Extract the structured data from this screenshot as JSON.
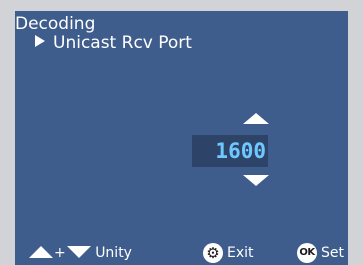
{
  "menu": {
    "title": "Decoding",
    "submenu": "Unicast Rcv Port"
  },
  "editor": {
    "value": "1600"
  },
  "footer": {
    "plus": "+",
    "unity_label": "Unity",
    "exit_label": "Exit",
    "ok_icon_text": "OK",
    "set_label": "Set"
  },
  "colors": {
    "screen_background": "#3f5d8c",
    "value_background": "#2d4468",
    "value_text": "#6ec8ff"
  },
  "icons": {
    "submenu_arrow": "play-right-icon",
    "increment": "arrow-up-icon",
    "decrement": "arrow-down-icon",
    "exit": "gear-icon",
    "set": "ok-icon"
  }
}
